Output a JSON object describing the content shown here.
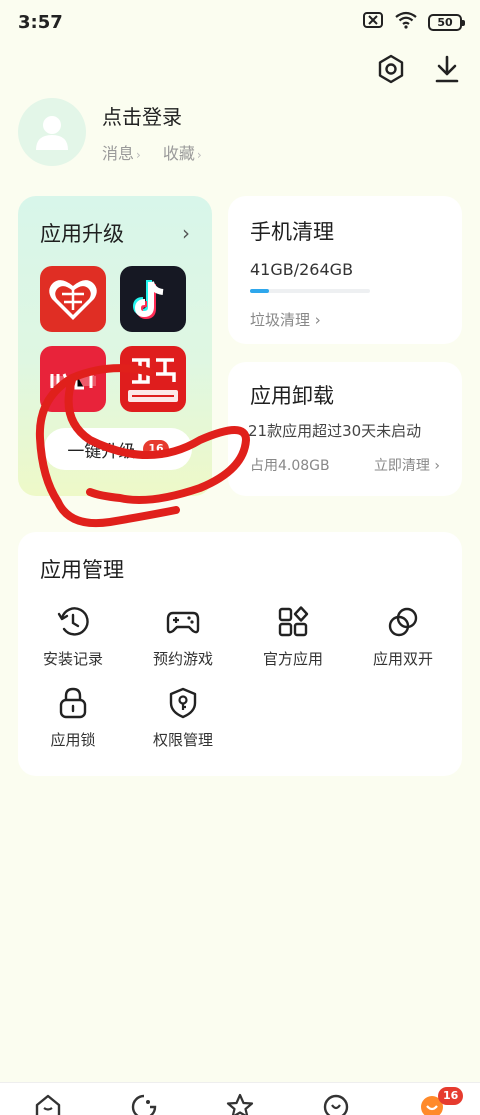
{
  "status_bar": {
    "time": "3:57",
    "battery": "50"
  },
  "profile": {
    "login_text": "点击登录",
    "links": [
      "消息",
      "收藏"
    ]
  },
  "upgrade_card": {
    "title": "应用升级",
    "button_label": "一键升级",
    "badge": "16"
  },
  "clean_card": {
    "title": "手机清理",
    "storage": "41GB/264GB",
    "progress": 0.16,
    "link": "垃圾清理 ›"
  },
  "uninstall_card": {
    "title": "应用卸载",
    "description": "21款应用超过30天未启动",
    "usage": "占用4.08GB",
    "action": "立即清理 ›"
  },
  "manage": {
    "title": "应用管理",
    "items": [
      {
        "label": "安装记录",
        "icon": "history-icon"
      },
      {
        "label": "预约游戏",
        "icon": "gamepad-icon"
      },
      {
        "label": "官方应用",
        "icon": "apps-grid-icon"
      },
      {
        "label": "应用双开",
        "icon": "dual-app-icon"
      },
      {
        "label": "应用锁",
        "icon": "lock-icon"
      },
      {
        "label": "权限管理",
        "icon": "shield-key-icon"
      }
    ]
  },
  "bottom_nav": {
    "badge": "16"
  },
  "colors": {
    "accent": "#2ea7ec",
    "badge": "#e63b2e",
    "annotation": "#e0201b"
  }
}
